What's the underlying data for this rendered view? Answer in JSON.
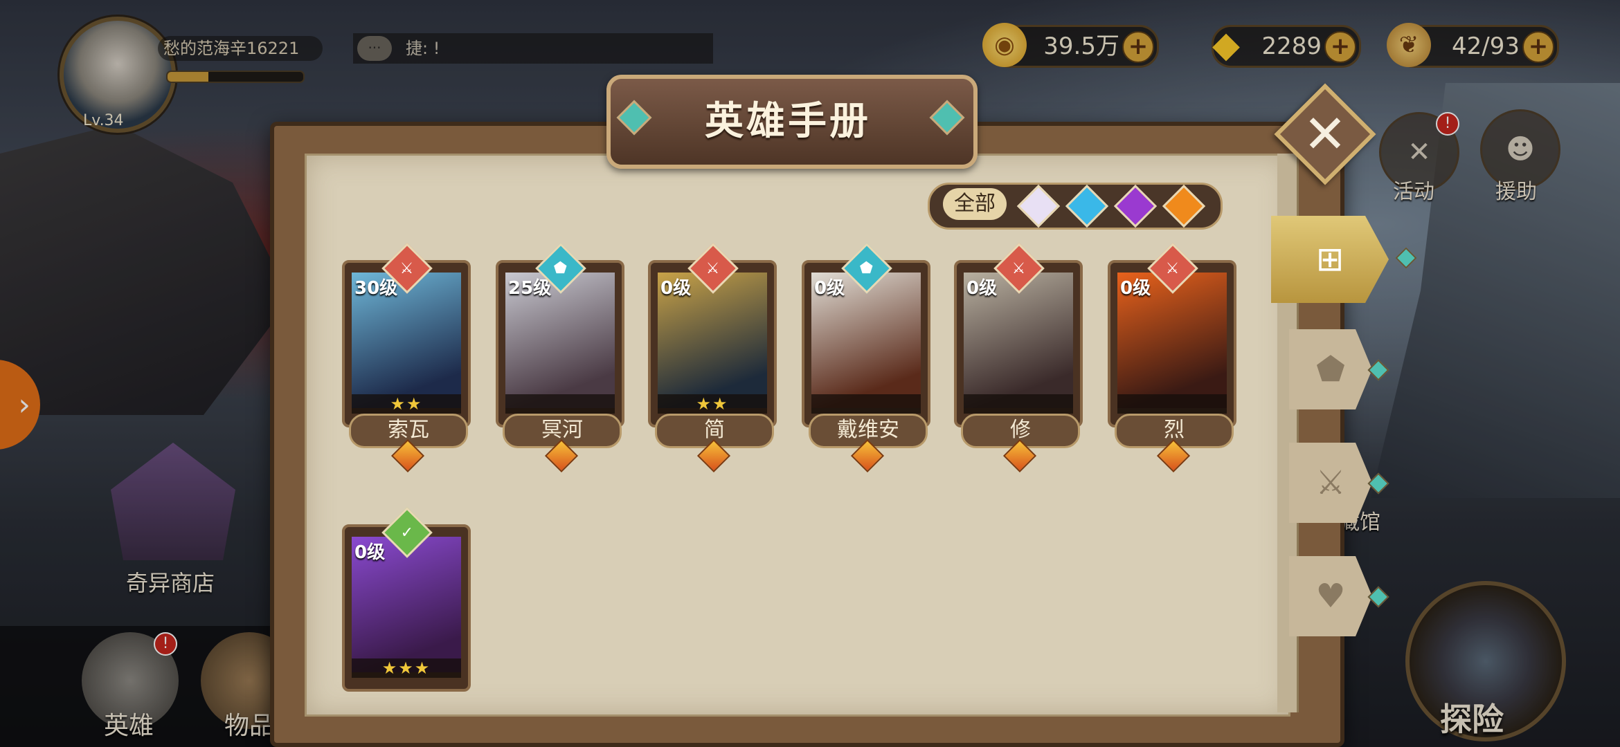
{
  "player": {
    "name": "愁的范海辛16221",
    "level": "Lv.34",
    "xp_progress": 0.3
  },
  "chat": {
    "text": "捷: !"
  },
  "resources": [
    {
      "icon": "gold-coin-icon",
      "value": "39.5万"
    },
    {
      "icon": "diamond-icon",
      "value": "2289"
    },
    {
      "icon": "stamina-icon",
      "value": "42/93"
    }
  ],
  "side_buttons": {
    "activity": "活动",
    "assist": "援助",
    "collection_partial": "藏馆"
  },
  "bottom": {
    "shop": "奇异商店",
    "hero": "英雄",
    "items": "物品",
    "explore": "探险"
  },
  "modal": {
    "title": "英雄手册",
    "filter_all": "全部",
    "filters": [
      {
        "name": "white-gem-filter",
        "color": "#e8e0f4"
      },
      {
        "name": "blue-gem-filter",
        "color": "#3ab8e8"
      },
      {
        "name": "purple-gem-filter",
        "color": "#9a3ad0"
      },
      {
        "name": "orange-gem-filter",
        "color": "#f08a1c"
      }
    ],
    "heroes": [
      {
        "name": "索瓦",
        "level": "30级",
        "stars": "★★",
        "role_color": "#d85a4a",
        "role_icon": "sword-icon",
        "colors": [
          "#6fb7d8",
          "#1d2a4a"
        ]
      },
      {
        "name": "冥河",
        "level": "25级",
        "stars": "",
        "role_color": "#3ab8c8",
        "role_icon": "shield-icon",
        "colors": [
          "#c8c8d0",
          "#4a3a44"
        ]
      },
      {
        "name": "简",
        "level": "0级",
        "stars": "★★",
        "role_color": "#d85a4a",
        "role_icon": "sword-icon",
        "colors": [
          "#c8a248",
          "#1d2a3a"
        ]
      },
      {
        "name": "戴维安",
        "level": "0级",
        "stars": "",
        "role_color": "#3ab8c8",
        "role_icon": "shield-icon",
        "colors": [
          "#e0dcd4",
          "#5a2a1a"
        ]
      },
      {
        "name": "修",
        "level": "0级",
        "stars": "",
        "role_color": "#d85a4a",
        "role_icon": "sword-icon",
        "colors": [
          "#b8b0a0",
          "#3a2a2a"
        ]
      },
      {
        "name": "烈",
        "level": "0级",
        "stars": "",
        "role_color": "#d85a4a",
        "role_icon": "sword-icon",
        "colors": [
          "#e8621c",
          "#3a1a14"
        ]
      },
      {
        "name": "",
        "level": "0级",
        "stars": "★★★",
        "role_color": "#6ab84a",
        "role_icon": "heal-icon",
        "colors": [
          "#8a4ad0",
          "#3a1a4a"
        ]
      }
    ]
  }
}
